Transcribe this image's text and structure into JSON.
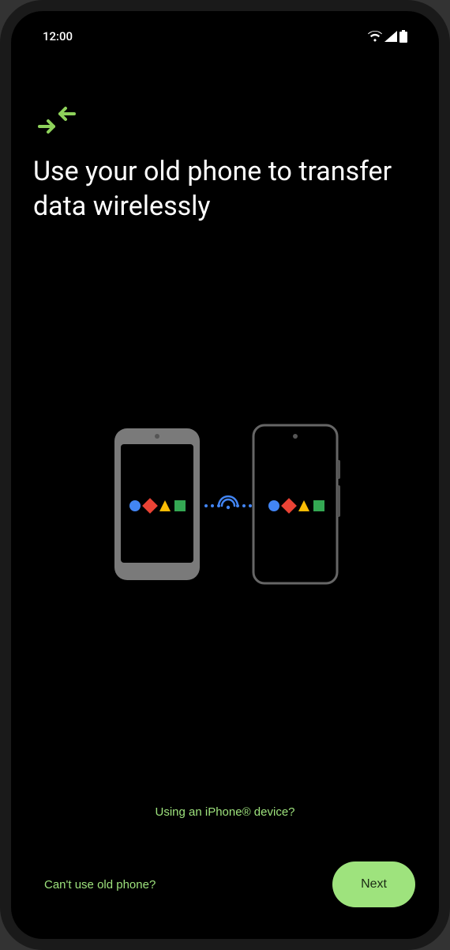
{
  "status": {
    "time": "12:00"
  },
  "header": {
    "title": "Use your old phone to transfer data wirelessly"
  },
  "links": {
    "iphone": "Using an iPhone® device?",
    "cant_use": "Can't use old phone?"
  },
  "buttons": {
    "next": "Next"
  }
}
